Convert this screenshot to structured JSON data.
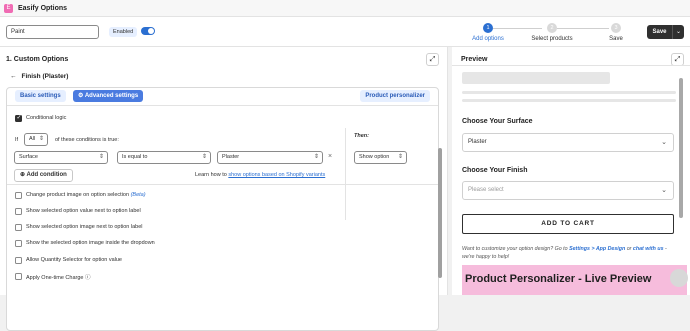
{
  "app": {
    "title": "Easify Options",
    "logo_glyph": "E"
  },
  "header": {
    "name_value": "Paint",
    "enabled_label": "Enabled",
    "toggle_on": true,
    "steps": [
      {
        "number": "1",
        "label": "Add options",
        "active": true
      },
      {
        "number": "2",
        "label": "Select products",
        "active": false
      },
      {
        "number": "3",
        "label": "Save",
        "active": false
      }
    ],
    "save_label": "Save",
    "save_dropdown_icon": "chevron-down-icon"
  },
  "left": {
    "title": "1. Custom Options",
    "back_label": "Finish (Plaster)",
    "back_icon": "arrow-left-icon",
    "tabs": {
      "basic": "Basic settings",
      "advanced": "Advanced settings",
      "personalizer": "Product personalizer"
    },
    "conditional_logic": {
      "label": "Conditional logic",
      "checked": true
    },
    "if_label": "If",
    "all_select": "All",
    "conditions_text": "of these conditions is true:",
    "then_label": "Then:",
    "condition": {
      "field": "Surface",
      "operator": "Is equal to",
      "value": "Plaster"
    },
    "remove_icon": "×",
    "then_select": "Show option",
    "add_condition_label": "Add condition",
    "learn_prefix": "Learn how to ",
    "learn_link": "show options based on Shopify variants",
    "options": [
      {
        "label": "Change product image on option selection",
        "beta": "(Beta)",
        "checked": false
      },
      {
        "label": "Show selected option value next to option label",
        "beta": "",
        "checked": false
      },
      {
        "label": "Show selected option image next to option label",
        "beta": "",
        "checked": false
      },
      {
        "label": "Show the selected option image inside the dropdown",
        "beta": "",
        "checked": false
      },
      {
        "label": "Allow Quantity Selector for option value",
        "beta": "",
        "checked": false
      },
      {
        "label": "Apply One-time Charge",
        "beta": "",
        "checked": false
      }
    ]
  },
  "preview": {
    "title": "Preview",
    "surface_label": "Choose Your Surface",
    "surface_value": "Plaster",
    "finish_label": "Choose Your Finish",
    "finish_placeholder": "Please select",
    "add_to_cart": "ADD TO CART",
    "help_prefix": "Want to customize your option design? Go to ",
    "help_link1": "Settings > App Design",
    "help_mid": " or ",
    "help_link2": "chat with us",
    "help_suffix": " - we're happy to help!",
    "banner": "Product Personalizer - Live Preview"
  },
  "colors": {
    "accent": "#2b6fd1",
    "banner": "#f6bcdc",
    "dark": "#303030"
  }
}
